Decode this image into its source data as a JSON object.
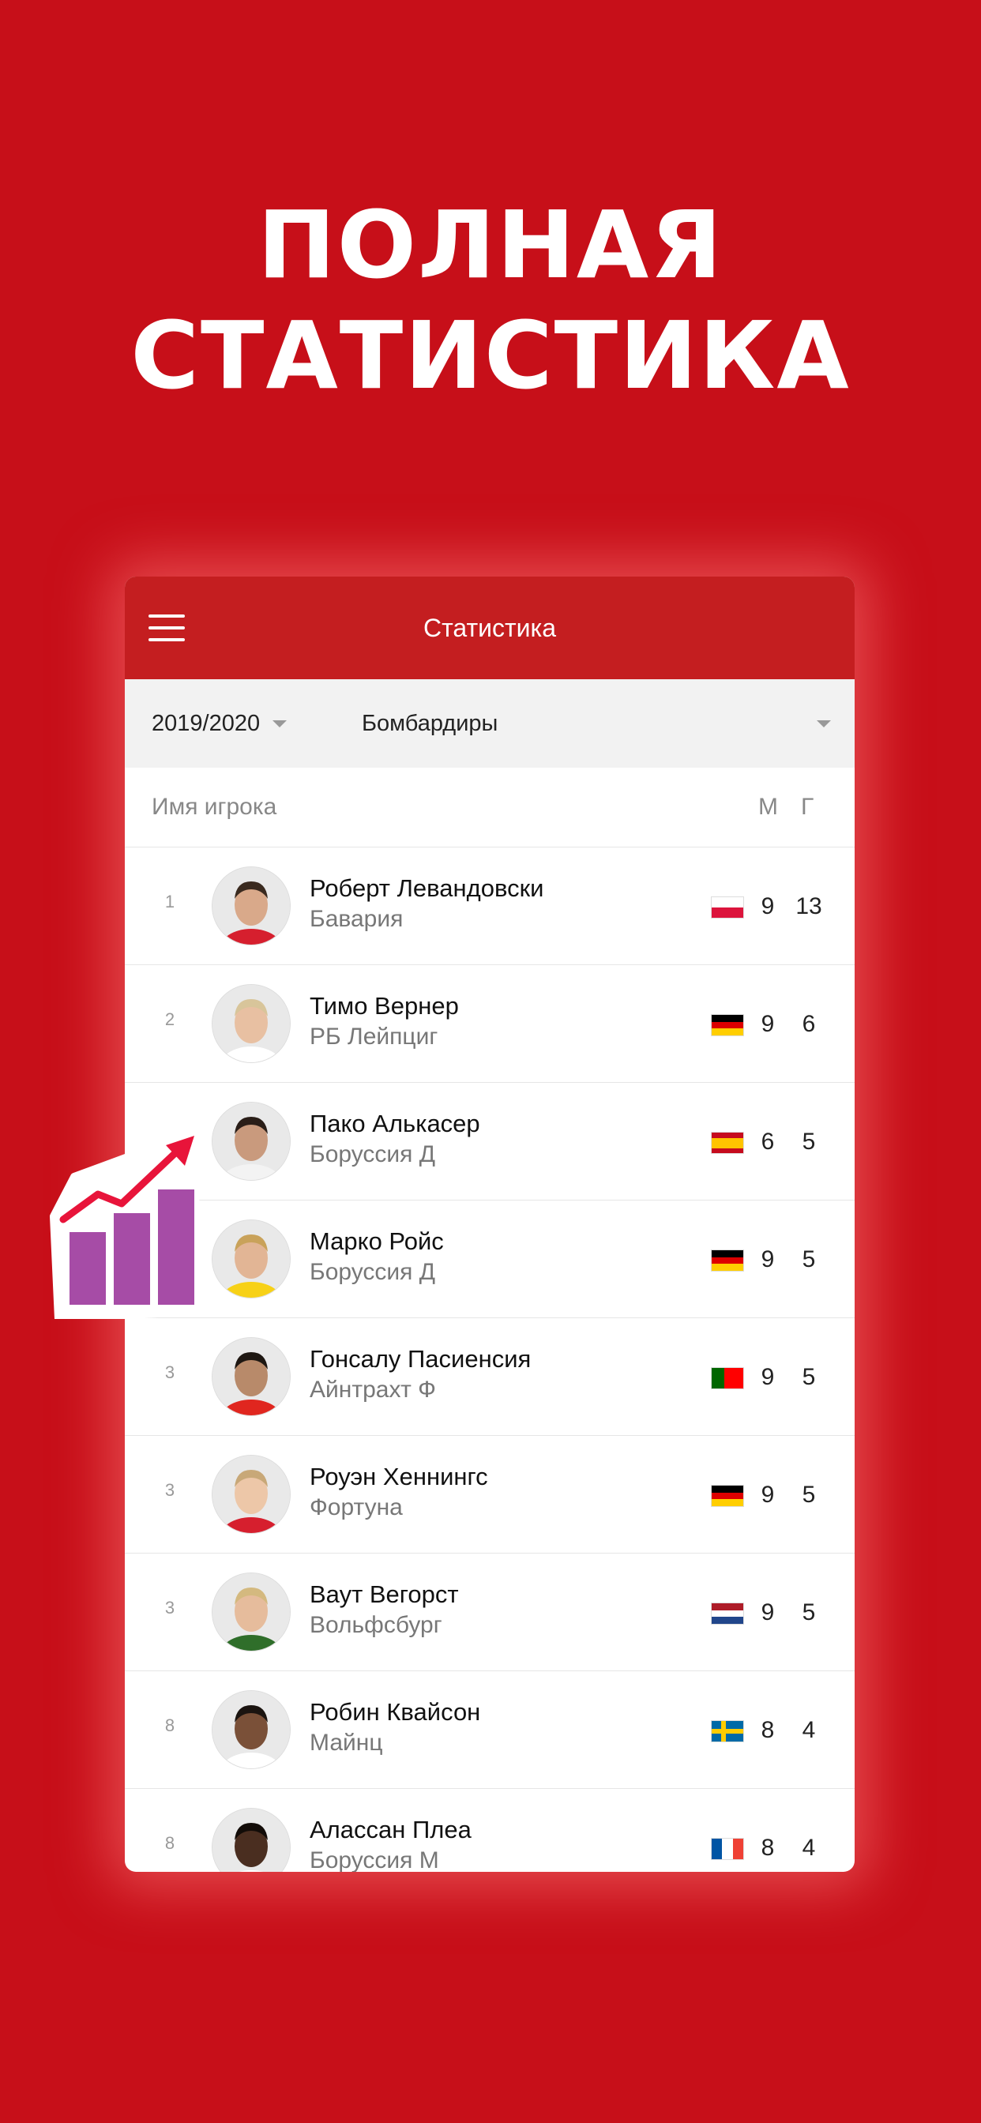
{
  "headline": {
    "line1": "ПОЛНАЯ",
    "line2": "СТАТИСТИКА"
  },
  "navbar": {
    "title": "Статистика",
    "menu_icon": "hamburger-icon"
  },
  "filters": {
    "season": "2019/2020",
    "type": "Бомбардиры"
  },
  "columns": {
    "player": "Имя игрока",
    "matches": "М",
    "goals": "Г"
  },
  "players": [
    {
      "rank": "1",
      "name": "Роберт Левандовски",
      "club": "Бавария",
      "flag": "poland",
      "m": "9",
      "g": "13"
    },
    {
      "rank": "2",
      "name": "Тимо Вернер",
      "club": "РБ Лейпциг",
      "flag": "germany",
      "m": "9",
      "g": "6"
    },
    {
      "rank": "",
      "name": "Пако Алькасер",
      "club": "Боруссия Д",
      "flag": "spain",
      "m": "6",
      "g": "5"
    },
    {
      "rank": "",
      "name": "Марко Ройс",
      "club": "Боруссия Д",
      "flag": "germany",
      "m": "9",
      "g": "5"
    },
    {
      "rank": "3",
      "name": "Гонсалу Пасиенсия",
      "club": "Айнтрахт Ф",
      "flag": "portugal",
      "m": "9",
      "g": "5"
    },
    {
      "rank": "3",
      "name": "Роуэн Хеннингс",
      "club": "Фортуна",
      "flag": "germany",
      "m": "9",
      "g": "5"
    },
    {
      "rank": "3",
      "name": "Ваут Вегорст",
      "club": "Вольфсбург",
      "flag": "netherlands",
      "m": "9",
      "g": "5"
    },
    {
      "rank": "8",
      "name": "Робин Квайсон",
      "club": "Майнц",
      "flag": "sweden",
      "m": "8",
      "g": "4"
    },
    {
      "rank": "8",
      "name": "Алассан Плеа",
      "club": "Боруссия М",
      "flag": "france",
      "m": "8",
      "g": "4"
    }
  ],
  "badge_icon": "growth-chart-icon",
  "colors": {
    "background": "#c70f19",
    "navbar": "#c41e20",
    "badge_bars": "#a64ca6",
    "arrow": "#e8143a"
  }
}
